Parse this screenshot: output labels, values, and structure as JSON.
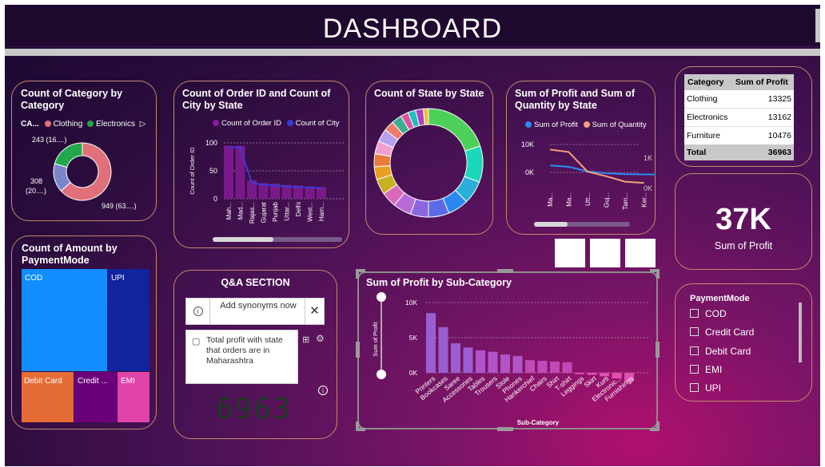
{
  "header": {
    "title": "DASHBOARD"
  },
  "category_card": {
    "title": "Count of Category by Category",
    "legend_title": "CA...",
    "legend": [
      {
        "name": "Clothing",
        "color": "#e0707a"
      },
      {
        "name": "Electronics",
        "color": "#22a84a"
      }
    ],
    "labels": {
      "top": "243 (16....)",
      "left_line1": "308",
      "left_line2": "(20....)",
      "right": "949 (63....)"
    }
  },
  "order_card": {
    "title": "Count of Order ID and Count of City by State",
    "legend": [
      {
        "name": "Count of Order ID",
        "color": "#8a1aa0"
      },
      {
        "name": "Count of City",
        "color": "#3a3ad8"
      }
    ],
    "ylabel": "Count of Order ID",
    "yticks": [
      "100",
      "50",
      "0"
    ],
    "xticks": [
      "Mah...",
      "Mad...",
      "Rajas...",
      "Gujarat",
      "Punjab",
      "Uttar...",
      "Delhi",
      "West...",
      "Harn..."
    ]
  },
  "state_card": {
    "title": "Count of State by State"
  },
  "profit_qty_card": {
    "title": "Sum of Profit and Sum of Quantity by State",
    "legend": [
      {
        "name": "Sum of Profit",
        "color": "#2a8cf0"
      },
      {
        "name": "Sum of Quantity",
        "color": "#f2a07a"
      }
    ],
    "yleft": [
      "10K",
      "0K"
    ],
    "yright": [
      "1K",
      "0K"
    ],
    "xticks": [
      "Ma...",
      "Ma...",
      "Utt...",
      "Guj...",
      "Tam...",
      "Ker..."
    ]
  },
  "table": {
    "headers": [
      "Category",
      "Sum of Profit"
    ],
    "rows": [
      [
        "Clothing",
        "13325"
      ],
      [
        "Electronics",
        "13162"
      ],
      [
        "Furniture",
        "10476"
      ]
    ],
    "total": [
      "Total",
      "36963"
    ]
  },
  "kpi": {
    "value": "37K",
    "label": "Sum of Profit"
  },
  "payment_card": {
    "title": "Count of Amount by PaymentMode",
    "tiles": [
      {
        "name": "COD",
        "color": "#118dff"
      },
      {
        "name": "UPI",
        "color": "#12239e"
      },
      {
        "name": "Debit Card",
        "color": "#e66c37"
      },
      {
        "name": "Credit ...",
        "color": "#6b007b"
      },
      {
        "name": "EMI",
        "color": "#e044a7"
      }
    ]
  },
  "qa": {
    "title": "Q&A SECTION",
    "synonyms_label": "Add synonyms now",
    "query": "Total profit with state that orders are in Maharashtra",
    "answer": "6963",
    "info_icon": "info-icon",
    "close_icon": "close-icon"
  },
  "subcat_card": {
    "title": "Sum of Profit by Sub-Category",
    "ylabel": "Sum of Profit",
    "xlabel": "Sub-Category",
    "yticks": [
      "10K",
      "5K",
      "0K"
    ]
  },
  "slicer": {
    "title": "PaymentMode",
    "options": [
      "COD",
      "Credit Card",
      "Debit Card",
      "EMI",
      "UPI"
    ]
  },
  "chart_data": [
    {
      "type": "pie",
      "title": "Count of Category by Category",
      "categories": [
        "Clothing",
        "Electronics",
        "Furniture"
      ],
      "values": [
        949,
        308,
        243
      ]
    },
    {
      "type": "bar",
      "title": "Count of Order ID and Count of City by State",
      "categories": [
        "Mah...",
        "Mad...",
        "Rajas...",
        "Gujarat",
        "Punjab",
        "Uttar...",
        "Delhi",
        "West...",
        "Harn..."
      ],
      "series": [
        {
          "name": "Count of Order ID",
          "values": [
            95,
            95,
            33,
            28,
            27,
            25,
            24,
            22,
            21
          ]
        },
        {
          "name": "Count of City",
          "values": [
            92,
            92,
            28,
            25,
            24,
            22,
            21,
            20,
            19
          ]
        }
      ],
      "ylim": [
        0,
        100
      ],
      "ylabel": "Count of Order ID"
    },
    {
      "type": "pie",
      "title": "Count of State by State",
      "values": [
        26,
        14,
        9,
        8,
        8,
        7,
        7,
        6,
        6,
        5,
        5,
        5,
        5,
        4,
        4,
        3,
        3,
        3,
        2
      ]
    },
    {
      "type": "line",
      "title": "Sum of Profit and Sum of Quantity by State",
      "x": [
        "Ma...",
        "Ma...",
        "Utt...",
        "Guj...",
        "Tam...",
        "Ker..."
      ],
      "series": [
        {
          "name": "Sum of Profit",
          "values": [
            2500,
            2000,
            400,
            -300,
            -600,
            -700
          ]
        },
        {
          "name": "Sum of Quantity",
          "values": [
            1280,
            1200,
            550,
            400,
            220,
            180
          ]
        }
      ]
    },
    {
      "type": "bar",
      "title": "Sum of Profit by Sub-Category",
      "xlabel": "Sub-Category",
      "ylabel": "Sum of Profit",
      "categories": [
        "Printers",
        "Bookcases",
        "Saree",
        "Accessories",
        "Tables",
        "Trousers",
        "Stole",
        "Phones",
        "Hankerchief",
        "Chairs",
        "Shirt",
        "T-shirt",
        "Leggings",
        "Skirt",
        "Kurti",
        "Electronic...",
        "Furnishings"
      ],
      "values": [
        8500,
        6500,
        4200,
        3600,
        3200,
        3000,
        2600,
        2400,
        1800,
        1700,
        1600,
        1500,
        -200,
        -300,
        -500,
        -800,
        -1300
      ],
      "ylim": [
        -1500,
        10000
      ]
    }
  ]
}
